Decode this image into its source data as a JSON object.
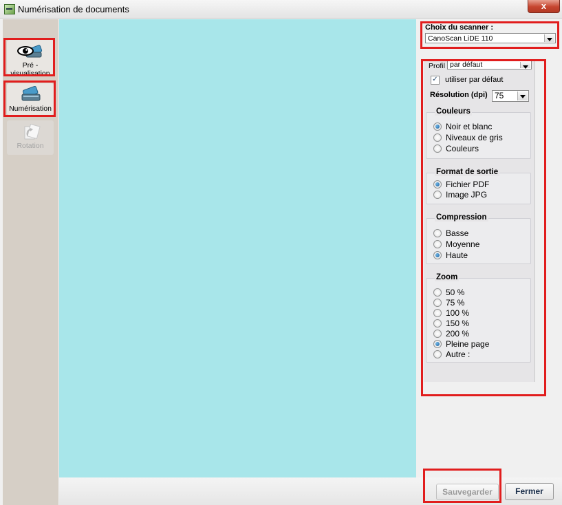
{
  "window": {
    "title": "Numérisation de documents",
    "close_glyph": "x"
  },
  "toolbar": {
    "items": [
      {
        "label": "Pré -\nvisualisation",
        "icon": "eye-scanner-icon",
        "enabled": true
      },
      {
        "label": "Numérisation",
        "icon": "scanner-icon",
        "enabled": true
      },
      {
        "label": "Rotation",
        "icon": "rotate-icon",
        "enabled": false
      }
    ]
  },
  "preview": {
    "background": "#a8e6ea"
  },
  "scanner": {
    "label": "Choix du scanner :",
    "selected": "CanoScan LiDE 110"
  },
  "settings": {
    "profile_label": "Profil",
    "profile_value": "par défaut",
    "use_default_label": "utiliser par défaut",
    "use_default_checked": true,
    "resolution_label": "Résolution (dpi)",
    "resolution_value": "75",
    "colors": {
      "title": "Couleurs",
      "options": [
        "Noir et blanc",
        "Niveaux de gris",
        "Couleurs"
      ],
      "selected": 0
    },
    "output_format": {
      "title": "Format de sortie",
      "options": [
        "Fichier PDF",
        "Image JPG"
      ],
      "selected": 0
    },
    "compression": {
      "title": "Compression",
      "options": [
        "Basse",
        "Moyenne",
        "Haute"
      ],
      "selected": 2
    },
    "zoom": {
      "title": "Zoom",
      "options": [
        "50 %",
        "75 %",
        "100 %",
        "150 %",
        "200 %",
        "Pleine page",
        "Autre :"
      ],
      "selected": 5
    }
  },
  "footer": {
    "save_label": "Sauvegarder",
    "save_enabled": false,
    "close_label": "Fermer"
  },
  "colors": {
    "highlight": "#e11d1d",
    "preview_bg": "#a8e6ea",
    "toolbar_bg": "#d6cfc6"
  }
}
